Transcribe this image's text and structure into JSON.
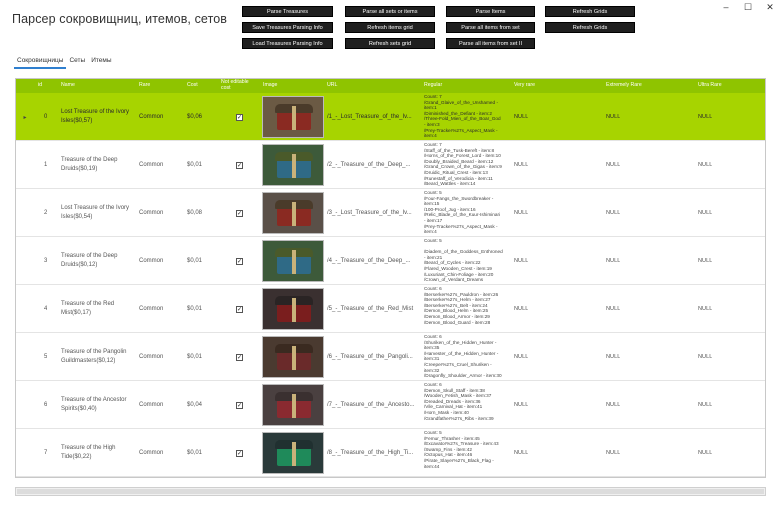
{
  "app": {
    "title": "Парсер сокровищниц, итемов, сетов"
  },
  "window_controls": {
    "minimize": "–",
    "maximize": "☐",
    "close": "✕"
  },
  "buttons": {
    "parse_treasures": "Parse Treasures",
    "save_treasures_info": "Save Treasures Parsing Info",
    "load_treasures_info": "Load Treasures Parsing Info",
    "parse_all_sets_or_items": "Parse all sets or items",
    "refresh_items_grid": "Refresh items grid",
    "refresh_sets_grid": "Refresh sets grid",
    "parse_items": "Parse Items",
    "parse_all_items_from_set": "Parse all items from set",
    "parse_all_items_from_set_ii": "Parse all items from set II",
    "refresh_grids": "Refresh Grids",
    "refresh_grids_2": "Refresh Grids"
  },
  "tabs": [
    "Сокровищницы",
    "Сеты",
    "Итемы"
  ],
  "columns": {
    "id": "id",
    "name": "Name",
    "rare": "Rare",
    "cost": "Cost",
    "not_editable_cost": "Not editable cost",
    "image": "Image",
    "url": "URL",
    "regular": "Regular",
    "very_rare": "Very rare",
    "extremely_rare": "Extremely Rare",
    "ultra_rare": "Ultra Rare"
  },
  "row_pointer": "▸",
  "check_glyph": "✓",
  "rows": [
    {
      "id": "0",
      "name": "Lost Treasure of the Ivory Isles($0,57)",
      "rare": "Common",
      "cost": "$0,06",
      "url": "/1_-_Lost_Treasure_of_the_Iv...",
      "regular": "Count: 7\n/Grand_Glaive_of_the_Unshamed -\nitem:1\n/Diminished_the_Defiant - item:2\n/Three-Fold_Mien_of_the_Boar_God\n- item:3\n/Prey-Tracker%27s_Aspect_Mask -\nitem:4",
      "very_rare": "NULL",
      "extremely_rare": "NULL",
      "ultra_rare": "NULL",
      "selected": true,
      "chest": [
        "#6b5a44",
        "#8a2a22",
        "#4a3b2a"
      ]
    },
    {
      "id": "1",
      "name": "Treasure of the Deep Druids($0,19)",
      "rare": "Common",
      "cost": "$0,01",
      "url": "/2_-_Treasure_of_the_Deep_...",
      "regular": "Count: 7\n/Staff_of_the_Tusk-Bereft - item:8\n/Horns_of_the_Forest_Lord - item:10\n/Doubly_Braided_Beard - item:12\n/Grand_Crown_of_the_Gigas - item:9\n/Druidic_Ritual_Crest - item:13\n/Runestaff_of_Verodicia - item:11\n/Beard_Wattles - item:14",
      "very_rare": "NULL",
      "extremely_rare": "NULL",
      "ultra_rare": "NULL",
      "selected": false,
      "chest": [
        "#3d5a3a",
        "#2f6a86",
        "#4a5a2a"
      ]
    },
    {
      "id": "2",
      "name": "Lost Treasure of the Ivory Isles($0,54)",
      "rare": "Common",
      "cost": "$0,08",
      "url": "/3_-_Lost_Treasure_of_the_Iv...",
      "regular": "Count: 5\n/Four-Fangs_the_Swordbreaker -\nitem:15\n/100-Proof_Jug - item:16\n/Relic_Blade_of_the_Kuur-Ishiminari\n- item:17\n/Prey-Tracker%27s_Aspect_Mask -\nitem:4",
      "very_rare": "NULL",
      "extremely_rare": "NULL",
      "ultra_rare": "NULL",
      "selected": false,
      "chest": [
        "#5a5048",
        "#8a2a22",
        "#4a3b2a"
      ]
    },
    {
      "id": "3",
      "name": "Treasure of the Deep Druids($0,12)",
      "rare": "Common",
      "cost": "$0,01",
      "url": "/4_-_Treasure_of_the_Deep_...",
      "regular": "Count: 5\n\n/Diadem_of_the_Goddess_Enthroned\n- item:21\n/Beard_of_Cycles - item:22\n/Flared_Wooden_Crest - item:19\n/Luxuriant_Chin-Foliage - item:20\n/Crown_of_Verdant_Dreams",
      "very_rare": "NULL",
      "extremely_rare": "NULL",
      "ultra_rare": "NULL",
      "selected": false,
      "chest": [
        "#3d5a3a",
        "#2f6a86",
        "#4a5a2a"
      ]
    },
    {
      "id": "4",
      "name": "Treasure of the Red Mist($0,17)",
      "rare": "Common",
      "cost": "$0,01",
      "url": "/5_-_Treasure_of_the_Red_Mist",
      "regular": "Count: 6\n/Berserker%27s_Pauldron - item:26\n/Berserker%27s_Helm - item:27\n/Berserker%27s_Belt - item:24\n/Demon_Blood_Helm - item:25\n/Demon_Blood_Armor - item:29\n/Demon_Blood_Guard - item:28",
      "very_rare": "NULL",
      "extremely_rare": "NULL",
      "ultra_rare": "NULL",
      "selected": false,
      "chest": [
        "#3a3030",
        "#7a1e1e",
        "#2a2424"
      ]
    },
    {
      "id": "5",
      "name": "Treasure of the Pangolin Guildmasters($0,12)",
      "rare": "Common",
      "cost": "$0,01",
      "url": "/6_-_Treasure_of_the_Pangoli...",
      "regular": "Count: 6\n/Shuriken_of_the_Hidden_Hunter -\nitem:35\n/Harvester_of_the_Hidden_Hunter -\nitem:31\n/Creeper%27s_Cruel_Shuriken -\nitem:32\n/Dragonfly_Shoulder_Armor - item:30",
      "very_rare": "NULL",
      "extremely_rare": "NULL",
      "ultra_rare": "NULL",
      "selected": false,
      "chest": [
        "#4a3a30",
        "#6a2a2a",
        "#3a2a20"
      ]
    },
    {
      "id": "6",
      "name": "Treasure of the Ancestor Spirits($0,40)",
      "rare": "Common",
      "cost": "$0,04",
      "url": "/7_-_Treasure_of_the_Ancesto...",
      "regular": "Count: 6\n/Demon_Skull_Staff - item:38\n/Wooden_Fetish_Mask - item:37\n/Dreaded_Dreads - item:36\n/Vile_Carnival_Hat - item:41\n/Horn_Mask - item:40\n/Grandfather%27s_Ribs - item:39",
      "very_rare": "NULL",
      "extremely_rare": "NULL",
      "ultra_rare": "NULL",
      "selected": false,
      "chest": [
        "#4a4040",
        "#8a2a30",
        "#3a3030"
      ]
    },
    {
      "id": "7",
      "name": "Treasure of the High Tide($0,22)",
      "rare": "Common",
      "cost": "$0,01",
      "url": "/8_-_Treasure_of_the_High_Ti...",
      "regular": "Count: 5\n/Femur_Thrasher - item:45\n/Excavator%27s_Treasure - item:43\n/Swamp_Fins - item:42\n/Octopus_Hat - item:46\n/Pirate_Slayer%27s_Black_Flag -\nitem:44",
      "very_rare": "NULL",
      "extremely_rare": "NULL",
      "ultra_rare": "NULL",
      "selected": false,
      "chest": [
        "#2a3a3a",
        "#1f8a5a",
        "#203030"
      ]
    }
  ]
}
